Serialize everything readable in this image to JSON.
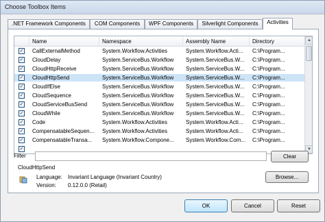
{
  "window": {
    "title": "Choose Toolbox Items"
  },
  "tabs": [
    {
      "label": ".NET Framework Components",
      "active": false
    },
    {
      "label": "COM Components",
      "active": false
    },
    {
      "label": "WPF Components",
      "active": false
    },
    {
      "label": "Silverlight Components",
      "active": false
    },
    {
      "label": "Activities",
      "active": true
    }
  ],
  "grid": {
    "columns": [
      "Name",
      "Namespace",
      "Assembly Name",
      "Directory"
    ],
    "rows": [
      {
        "checked": true,
        "name": "CallExternalMethod",
        "namespace": "System.Workflow.Activities",
        "assembly": "System.Workflow.Acti...",
        "directory": "C:\\Program..."
      },
      {
        "checked": true,
        "name": "CloudDelay",
        "namespace": "System.ServiceBus.Workflow",
        "assembly": "System.ServiceBus.W...",
        "directory": "C:\\Program..."
      },
      {
        "checked": true,
        "name": "CloudHttpReceive",
        "namespace": "System.ServiceBus.Workflow",
        "assembly": "System.ServiceBus.W...",
        "directory": "C:\\Program..."
      },
      {
        "checked": true,
        "name": "CloudHttpSend",
        "namespace": "System.ServiceBus.Workflow",
        "assembly": "System.ServiceBus.W...",
        "directory": "C:\\Program..."
      },
      {
        "checked": true,
        "name": "CloudIfElse",
        "namespace": "System.ServiceBus.Workflow",
        "assembly": "System.ServiceBus.W...",
        "directory": "C:\\Program..."
      },
      {
        "checked": true,
        "name": "CloudSequence",
        "namespace": "System.ServiceBus.Workflow",
        "assembly": "System.ServiceBus.W...",
        "directory": "C:\\Program..."
      },
      {
        "checked": true,
        "name": "CloudServiceBusSend",
        "namespace": "System.ServiceBus.Workflow",
        "assembly": "System.ServiceBus.W...",
        "directory": "C:\\Program..."
      },
      {
        "checked": true,
        "name": "CloudWhile",
        "namespace": "System.ServiceBus.Workflow",
        "assembly": "System.ServiceBus.W...",
        "directory": "C:\\Program..."
      },
      {
        "checked": true,
        "name": "Code",
        "namespace": "System.Workflow.Activities",
        "assembly": "System.Workflow.Acti...",
        "directory": "C:\\Program..."
      },
      {
        "checked": true,
        "name": "CompensatableSequen...",
        "namespace": "System.Workflow.Activities",
        "assembly": "System.Workflow.Acti...",
        "directory": "C:\\Program..."
      },
      {
        "checked": true,
        "name": "CompensatableTransa...",
        "namespace": "System.Workflow.Compone...",
        "assembly": "System.Workflow.Com...",
        "directory": "C:\\Program..."
      },
      {
        "checked": true,
        "name": "",
        "namespace": "",
        "assembly": "",
        "directory": ""
      }
    ]
  },
  "filter": {
    "label": "Filter",
    "value": "",
    "clear_label": "Clear"
  },
  "selected_item": {
    "name": "CloudHttpSend",
    "language_label": "Language:",
    "language_value": "Invariant Language (Invariant Country)",
    "version_label": "Version:",
    "version_value": "0.12.0.0 (Retail)",
    "browse_label": "Browse..."
  },
  "footer": {
    "ok_label": "OK",
    "cancel_label": "Cancel",
    "reset_label": "Reset"
  }
}
